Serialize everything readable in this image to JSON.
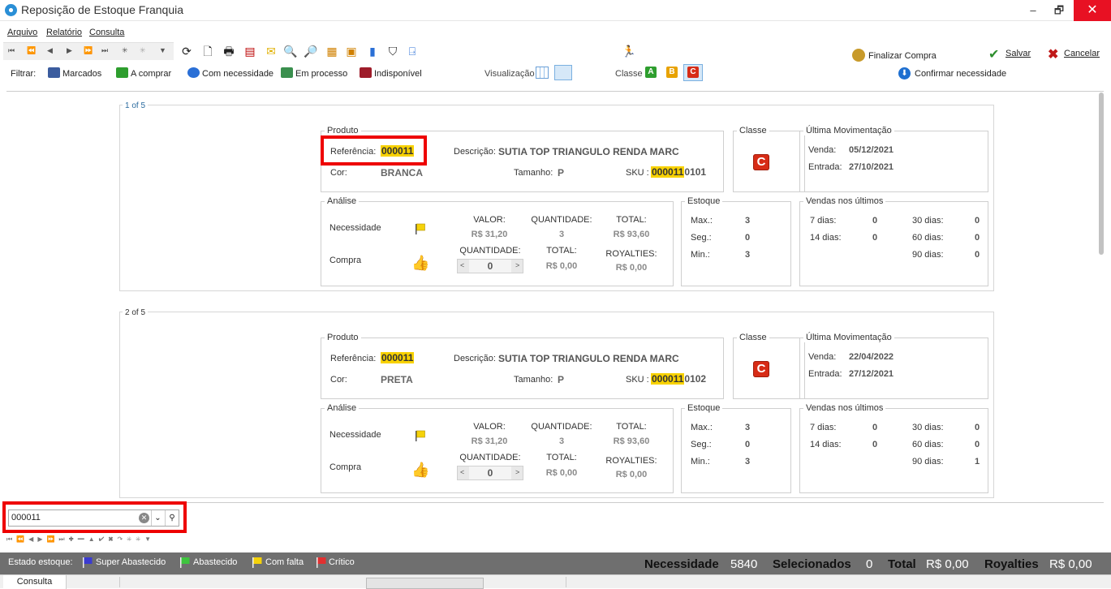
{
  "window": {
    "title": "Reposição de Estoque Franquia",
    "minimize": "–",
    "restore": "🗗",
    "close": "✕"
  },
  "menu": [
    "Arquivo",
    "Relatório",
    "Consulta"
  ],
  "filters": {
    "label": "Filtrar:",
    "items": [
      "Marcados",
      "A comprar",
      "Com necessidade",
      "Em processo",
      "Indisponível"
    ]
  },
  "visualizacao": {
    "label": "Visualização"
  },
  "classe": {
    "label": "Classe",
    "options": [
      "A",
      "B",
      "C"
    ],
    "selected": "C"
  },
  "actions": {
    "finalizar": "Finalizar Compra",
    "salvar": "Salvar",
    "cancelar": "Cancelar",
    "confirmar": "Confirmar necessidade"
  },
  "cards": [
    {
      "counter": "1 of 5",
      "produto": {
        "title": "Produto",
        "referencia_label": "Referência:",
        "referencia": "000011",
        "descricao_label": "Descrição:",
        "descricao": "SUTIA TOP TRIANGULO RENDA MARC",
        "cor_label": "Cor:",
        "cor": "BRANCA",
        "tamanho_label": "Tamanho:",
        "tamanho": "P",
        "sku_label": "SKU :",
        "sku_hl": "000011",
        "sku_rest": "0101"
      },
      "classe": {
        "title": "Classe",
        "value": "C"
      },
      "ultima": {
        "title": "Última Movimentação",
        "venda_label": "Venda:",
        "venda": "05/12/2021",
        "entrada_label": "Entrada:",
        "entrada": "27/10/2021"
      },
      "analise": {
        "title": "Análise",
        "necessidade_label": "Necessidade",
        "compra_label": "Compra",
        "valor_label": "VALOR:",
        "valor": "R$ 31,20",
        "qtd_label": "QUANTIDADE:",
        "qtd": "3",
        "total_label": "TOTAL:",
        "total": "R$ 93,60",
        "compra_qtd_label": "QUANTIDADE:",
        "compra_qtd": "0",
        "compra_total_label": "TOTAL:",
        "compra_total": "R$ 0,00",
        "royalties_label": "ROYALTIES:",
        "royalties": "R$ 0,00"
      },
      "estoque": {
        "title": "Estoque",
        "max_label": "Max.:",
        "max": "3",
        "seg_label": "Seg.:",
        "seg": "0",
        "min_label": "Min.:",
        "min": "3"
      },
      "vendas": {
        "title": "Vendas nos últimos",
        "d7_label": "7 dias:",
        "d7": "0",
        "d14_label": "14 dias:",
        "d14": "0",
        "d30_label": "30 dias:",
        "d30": "0",
        "d60_label": "60 dias:",
        "d60": "0",
        "d90_label": "90 dias:",
        "d90": "0"
      }
    },
    {
      "counter": "2 of 5",
      "produto": {
        "title": "Produto",
        "referencia_label": "Referência:",
        "referencia": "000011",
        "descricao_label": "Descrição:",
        "descricao": "SUTIA TOP TRIANGULO RENDA MARC",
        "cor_label": "Cor:",
        "cor": "PRETA",
        "tamanho_label": "Tamanho:",
        "tamanho": "P",
        "sku_label": "SKU :",
        "sku_hl": "000011",
        "sku_rest": "0102"
      },
      "classe": {
        "title": "Classe",
        "value": "C"
      },
      "ultima": {
        "title": "Última Movimentação",
        "venda_label": "Venda:",
        "venda": "22/04/2022",
        "entrada_label": "Entrada:",
        "entrada": "27/12/2021"
      },
      "analise": {
        "title": "Análise",
        "necessidade_label": "Necessidade",
        "compra_label": "Compra",
        "valor_label": "VALOR:",
        "valor": "R$ 31,20",
        "qtd_label": "QUANTIDADE:",
        "qtd": "3",
        "total_label": "TOTAL:",
        "total": "R$ 93,60",
        "compra_qtd_label": "QUANTIDADE:",
        "compra_qtd": "0",
        "compra_total_label": "TOTAL:",
        "compra_total": "R$ 0,00",
        "royalties_label": "ROYALTIES:",
        "royalties": "R$ 0,00"
      },
      "estoque": {
        "title": "Estoque",
        "max_label": "Max.:",
        "max": "3",
        "seg_label": "Seg.:",
        "seg": "0",
        "min_label": "Min.:",
        "min": "3"
      },
      "vendas": {
        "title": "Vendas nos últimos",
        "d7_label": "7 dias:",
        "d7": "0",
        "d14_label": "14 dias:",
        "d14": "0",
        "d30_label": "30 dias:",
        "d30": "0",
        "d60_label": "60 dias:",
        "d60": "0",
        "d90_label": "90 dias:",
        "d90": "1"
      }
    }
  ],
  "search": {
    "value": "000011"
  },
  "status": {
    "estado_label": "Estado estoque:",
    "legend": [
      "Super Abastecido",
      "Abastecido",
      "Com falta",
      "Crítico"
    ],
    "necessidade_label": "Necessidade",
    "necessidade": "5840",
    "selecionados_label": "Selecionados",
    "selecionados": "0",
    "total_label": "Total",
    "total": "R$ 0,00",
    "royalties_label": "Royalties",
    "royalties": "R$ 0,00"
  },
  "bottom_tab": "Consulta",
  "colors": {
    "highlight": "#f8d200",
    "class_c": "#d72c16",
    "class_a": "#2e9e2e",
    "class_b": "#e8a200",
    "redbox": "#e00000"
  }
}
